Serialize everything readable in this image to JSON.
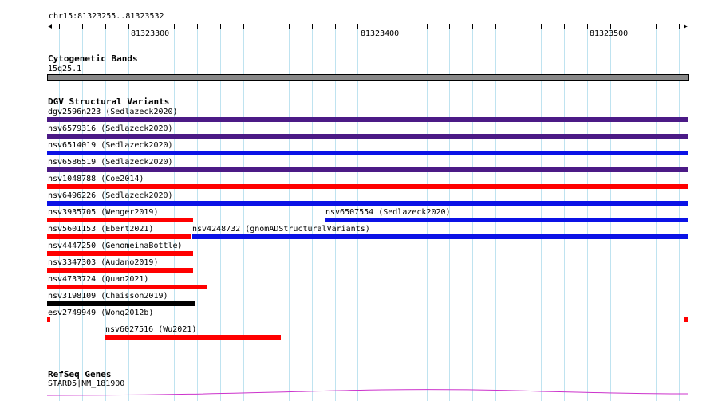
{
  "ruler": {
    "location": "chr15:81323255..81323532",
    "ticks": [
      "81323300",
      "81323400",
      "81323500"
    ]
  },
  "tracks": {
    "cytoband": {
      "title": "Cytogenetic Bands",
      "band_label": "15q25.1",
      "band_color": "#888888"
    },
    "dgv": {
      "title": "DGV Structural Variants",
      "colors": {
        "purple": "#4b1a86",
        "blue": "#0b12e6",
        "red": "#ff0000",
        "black": "#000000"
      },
      "features": [
        {
          "label": "dgv2596n223 (Sedlazeck2020)",
          "color": "purple"
        },
        {
          "label": "nsv6579316 (Sedlazeck2020)",
          "color": "purple"
        },
        {
          "label": "nsv6514019 (Sedlazeck2020)",
          "color": "blue"
        },
        {
          "label": "nsv6586519 (Sedlazeck2020)",
          "color": "purple"
        },
        {
          "label": "nsv1048788 (Coe2014)",
          "color": "red"
        },
        {
          "label": "nsv6496226 (Sedlazeck2020)",
          "color": "blue"
        },
        {
          "label": "nsv3935705 (Wenger2019)",
          "color": "red"
        },
        {
          "label": "nsv6507554 (Sedlazeck2020)",
          "color": "blue"
        },
        {
          "label": "nsv5601153 (Ebert2021)",
          "color": "red"
        },
        {
          "label": "nsv4248732 (gnomADStructuralVariants)",
          "color": "blue"
        },
        {
          "label": "nsv4447250 (GenomeinaBottle)",
          "color": "red"
        },
        {
          "label": "nsv3347303 (Audano2019)",
          "color": "red"
        },
        {
          "label": "nsv4733724 (Quan2021)",
          "color": "red"
        },
        {
          "label": "nsv3198109 (Chaisson2019)",
          "color": "black"
        },
        {
          "label": "esv2749949 (Wong2012b)",
          "color": "red"
        },
        {
          "label": "nsv6027516 (Wu2021)",
          "color": "red"
        }
      ]
    },
    "refseq": {
      "title": "RefSeq Genes",
      "gene_label": "STARD5|NM_181900",
      "gene_color": "#cc33cc"
    }
  }
}
